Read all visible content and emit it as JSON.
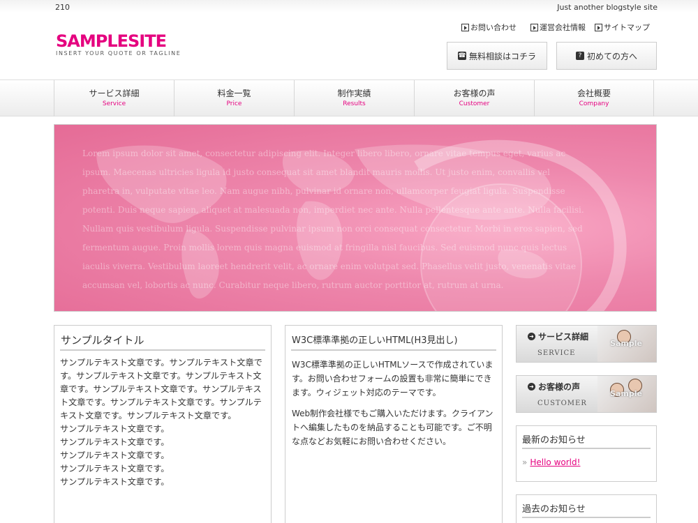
{
  "header": {
    "site_number": "210",
    "description": "Just another blogstyle site",
    "logo": "SAMPLESITE",
    "tagline": "INSERT YOUR QUOTE OR TAGLINE",
    "util_links": [
      "お問い合わせ",
      "運営会社情報",
      "サイトマップ"
    ],
    "buttons": [
      {
        "label": "無料相談はコチラ",
        "icon": "phone-icon"
      },
      {
        "label": "初めての方へ",
        "icon": "question-icon"
      }
    ]
  },
  "nav": {
    "items": [
      {
        "jp": "サービス詳細",
        "en": "Service"
      },
      {
        "jp": "料金一覧",
        "en": "Price"
      },
      {
        "jp": "制作実績",
        "en": "Results"
      },
      {
        "jp": "お客様の声",
        "en": "Customer"
      },
      {
        "jp": "会社概要",
        "en": "Company"
      }
    ]
  },
  "hero": {
    "text": "Lorem ipsum dolor sit amet, consectetur adipiscing elit. Integer libero libero, ornare vitae tempus eget, varius ac ipsum. Maecenas ultricies ligula id justo consequat sit amet blandit mauris mollis. Ut justo enim, convallis vel pharetra in, vulputate vitae leo. Nam augue nibh, pulvinar id ornare non, ullamcorper feugiat ligula. Suspendisse potenti. Duis neque sapien, aliquet at malesuada non, imperdiet nec ante. Nulla pellentesque ante ante. Nulla facilisi. Nullam quis vestibulum ligula. Suspendisse pulvinar ipsum non orci consequat consectetur. Morbi in eros sapien, sed fermentum augue. Proin mollis lorem quis magna euismod at fringilla nisl faucibus. Sed euismod nunc quis lectus iaculis viverra. Vestibulum laoreet hendrerit velit, ac ornare enim volutpat sed. Phasellus velit justo, venenatis vitae accumsan vel, lobortis ac nunc. Curabitur neque libero, rutrum auctor porttitor at, rutrum at urna."
  },
  "col1": {
    "title": "サンプルタイトル",
    "body": "サンプルテキスト文章です。サンプルテキスト文章です。サンプルテキスト文章です。サンプルテキスト文章です。サンプルテキスト文章です。サンプルテキスト文章です。サンプルテキスト文章です。サンプルテキスト文章です。サンプルテキスト文章です。",
    "lines": [
      "サンプルテキスト文章です。",
      "サンプルテキスト文章です。",
      "サンプルテキスト文章です。",
      "サンプルテキスト文章です。",
      "サンプルテキスト文章です。"
    ]
  },
  "col2": {
    "title": "W3C標準準拠の正しいHTML(H3見出し)",
    "p1": "W3C標準準拠の正しいHTMLソースで作成されています。お問い合わせフォームの設置も非常に簡単にできます。ウィジェット対応のテーマです。",
    "p2": "Web制作会社様でもご購入いただけます。クライアントへ編集したものを納品することも可能です。ご不明な点などお気軽にお問い合わせください。"
  },
  "sidebar": {
    "banners": [
      {
        "title": "サービス詳細",
        "en": "SERVICE",
        "badge": "Sample"
      },
      {
        "title": "お客様の声",
        "en": "CUSTOMER",
        "badge": "Sample"
      }
    ],
    "news_title": "最新のお知らせ",
    "news_link": "Hello world!",
    "past_title": "過去のお知らせ"
  },
  "colors": {
    "accent": "#e5007f"
  }
}
